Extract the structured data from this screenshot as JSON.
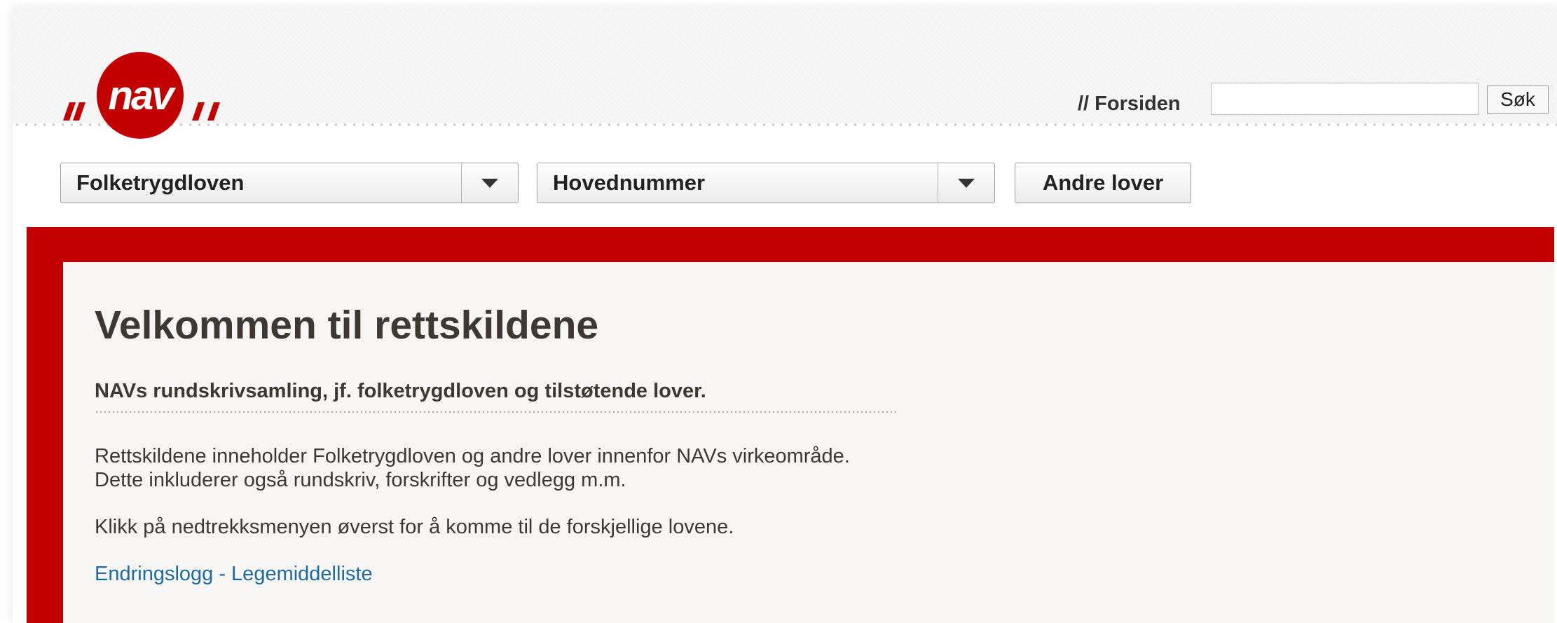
{
  "header": {
    "logo_text": "nav",
    "forsiden_label": "// Forsiden",
    "search_value": "",
    "search_button_label": "Søk",
    "brand_red": "#c30000"
  },
  "toolbar": {
    "law_select": {
      "selected": "Folketrygdloven",
      "icon": "chevron-down-icon"
    },
    "chapter_select": {
      "selected": "Hovednummer",
      "icon": "chevron-down-icon"
    },
    "other_laws_label": "Andre lover"
  },
  "main": {
    "title": "Velkommen til rettskildene",
    "subtitle": "NAVs rundskrivsamling, jf. folketrygdloven og tilstøtende lover.",
    "paragraph_line_1": "Rettskildene inneholder Folketrygdloven og andre lover innenfor NAVs virkeområde.",
    "paragraph_line_2": "Dette inkluderer også rundskriv, forskrifter og vedlegg m.m.",
    "instruction": "Klikk på nedtrekksmenyen øverst for å komme til de forskjellige lovene.",
    "link_label": "Endringslogg - Legemiddelliste",
    "text_color": "#3e3833",
    "link_color": "#1d6aa5"
  }
}
